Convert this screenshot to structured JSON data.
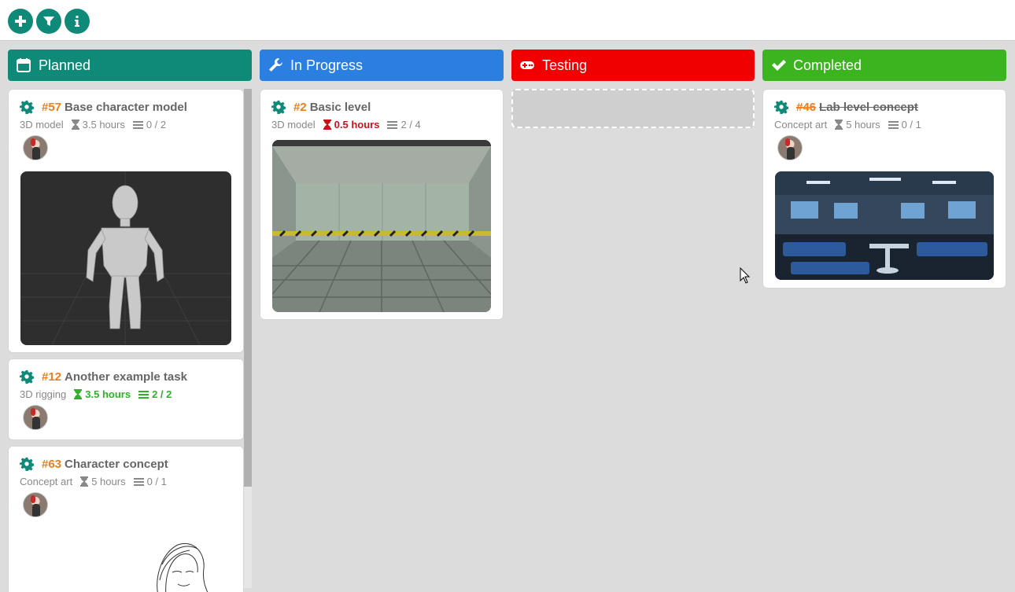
{
  "toolbar": {
    "buttons": [
      {
        "name": "add-button",
        "icon": "plus-icon"
      },
      {
        "name": "filter-button",
        "icon": "filter-icon"
      },
      {
        "name": "info-button",
        "icon": "info-icon"
      }
    ]
  },
  "columns": [
    {
      "title": "Planned",
      "icon": "calendar-icon",
      "color": "#108a78"
    },
    {
      "title": "In Progress",
      "icon": "wrench-icon",
      "color": "#2a7fe0"
    },
    {
      "title": "Testing",
      "icon": "gamepad-icon",
      "color": "#f00000"
    },
    {
      "title": "Completed",
      "icon": "check-icon",
      "color": "#3bb41f"
    }
  ],
  "cards": {
    "c57": {
      "number": "#57",
      "title": "Base character model",
      "category": "3D model",
      "hours": "3.5 hours",
      "subtasks": "0 / 2"
    },
    "c12": {
      "number": "#12",
      "title": "Another example task",
      "category": "3D rigging",
      "hours": "3.5 hours",
      "subtasks": "2 / 2"
    },
    "c63": {
      "number": "#63",
      "title": "Character concept",
      "category": "Concept art",
      "hours": "5 hours",
      "subtasks": "0 / 1"
    },
    "c2": {
      "number": "#2",
      "title": "Basic level",
      "category": "3D model",
      "hours": "0.5 hours",
      "subtasks": "2 / 4"
    },
    "c46": {
      "number": "#46",
      "title": "Lab level concept",
      "category": "Concept art",
      "hours": "5 hours",
      "subtasks": "0 / 1"
    }
  },
  "colors": {
    "accent": "#108a78",
    "task_number": "#f07d1b",
    "overdue": "#c9131b",
    "complete": "#2fb12a"
  }
}
